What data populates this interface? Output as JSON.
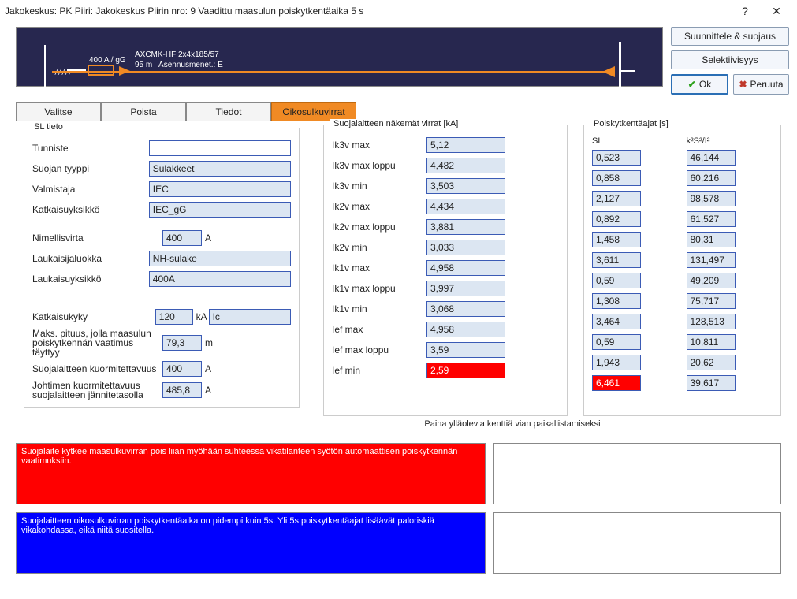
{
  "title": "Jakokeskus: PK    Piiri: Jakokeskus    Piirin nro: 9   Vaadittu maasulun poiskytkentäaika 5 s",
  "banner": {
    "rating": "400 A / gG",
    "cable": "AXCMK-HF 2x4x185/57",
    "len": "95 m",
    "install": "Asennusmenet.: E"
  },
  "buttons": {
    "suunnittele": "Suunnittele & suojaus",
    "selektiivisyys": "Selektiivisyys",
    "ok": "Ok",
    "peruuta": "Peruuta"
  },
  "tabs": {
    "valitse": "Valitse",
    "poista": "Poista",
    "tiedot": "Tiedot",
    "oikosulku": "Oikosulkuvirrat"
  },
  "sl": {
    "title": "SL tieto",
    "tunniste_l": "Tunniste",
    "tunniste": "",
    "tyyppi_l": "Suojan tyyppi",
    "tyyppi": "Sulakkeet",
    "valmistaja_l": "Valmistaja",
    "valmistaja": "IEC",
    "katkykk_l": "Katkaisuyksikkö",
    "katkykk": "IEC_gG",
    "nimellis_l": "Nimellisvirta",
    "nimellis": "400",
    "nimellis_u": "A",
    "lauk_l": "Laukaisijaluokka",
    "lauk": "NH-sulake",
    "laukk_l": "Laukaisuyksikkö",
    "laukk": "400A",
    "katkkyky_l": "Katkaisukyky",
    "katkkyky": "120",
    "katkkyky_u": "kA",
    "ic": "Ic",
    "maks_l": "Maks. pituus, jolla maasulun poiskytkennän vaatimus täyttyy",
    "maks": "79,3",
    "maks_u": "m",
    "suoj_l": "Suojalaitteen kuormitettavuus",
    "suoj": "400",
    "suoj_u": "A",
    "joht_l": "Johtimen kuormitettavuus suojalaitteen jännitetasolla",
    "joht": "485,8",
    "joht_u": "A"
  },
  "currents": {
    "title": "Suojalaitteen näkemät virrat [kA]",
    "rows": [
      {
        "l": "Ik3v max",
        "v": "5,12"
      },
      {
        "l": "Ik3v max loppu",
        "v": "4,482"
      },
      {
        "l": "Ik3v min",
        "v": "3,503"
      },
      {
        "l": "Ik2v max",
        "v": "4,434"
      },
      {
        "l": "Ik2v max loppu",
        "v": "3,881"
      },
      {
        "l": "Ik2v min",
        "v": "3,033"
      },
      {
        "l": "Ik1v max",
        "v": "4,958"
      },
      {
        "l": "Ik1v max loppu",
        "v": "3,997"
      },
      {
        "l": "Ik1v min",
        "v": "3,068"
      },
      {
        "l": "Ief max",
        "v": "4,958"
      },
      {
        "l": "Ief max loppu",
        "v": "3,59"
      },
      {
        "l": "Ief min",
        "v": "2,59",
        "red": true
      }
    ]
  },
  "poisk": {
    "title": "Poiskytkentäajat [s]",
    "h1": "SL",
    "h2": "k²S²/I²",
    "rows": [
      {
        "sl": "0,523",
        "k": "46,144"
      },
      {
        "sl": "0,858",
        "k": "60,216"
      },
      {
        "sl": "2,127",
        "k": "98,578"
      },
      {
        "sl": "0,892",
        "k": "61,527"
      },
      {
        "sl": "1,458",
        "k": "80,31"
      },
      {
        "sl": "3,611",
        "k": "131,497"
      },
      {
        "sl": "0,59",
        "k": "49,209"
      },
      {
        "sl": "1,308",
        "k": "75,717"
      },
      {
        "sl": "3,464",
        "k": "128,513"
      },
      {
        "sl": "0,59",
        "k": "10,811"
      },
      {
        "sl": "1,943",
        "k": "20,62"
      },
      {
        "sl": "6,461",
        "k": "39,617",
        "red": true
      }
    ]
  },
  "caption": "Paina ylläolevia kenttiä vian paikallistamiseksi",
  "msg1": "Suojalaite kytkee maasulkuvirran pois liian myöhään suhteessa vikatilanteen syötön automaattisen poiskytkennän vaatimuksiin.",
  "msg2": "Suojalaitteen oikosulkuvirran poiskytkentäaika on pidempi kuin 5s. Yli 5s poiskytkentäajat lisäävät paloriskiä vikakohdassa, eikä niitä suositella."
}
